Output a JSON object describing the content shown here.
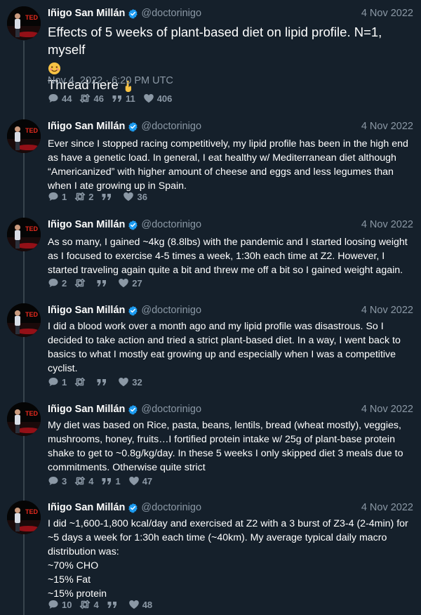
{
  "author": {
    "name": "Iñigo San Millán",
    "handle": "@doctorinigo",
    "avatar_text": "TED"
  },
  "colors": {
    "background": "#15202b",
    "text": "#ffffff",
    "muted": "#8b98a5",
    "verified": "#1d9bf0",
    "thread_line": "#38444d"
  },
  "tweets": [
    {
      "date": "4 Nov 2022",
      "lines": [
        "Effects of 5 weeks of plant-based diet on lipid profile. N=1, myself"
      ],
      "line2": "Thread here",
      "timestamp": "Nov 4, 2022 · 6:20 PM UTC",
      "replies": "44",
      "retweets": "46",
      "quotes": "11",
      "likes": "406"
    },
    {
      "date": "4 Nov 2022",
      "lines": [
        "Ever since I stopped racing competitively, my lipid profile has been in the high end",
        "as have a genetic load. In general, I eat healthy w/ Mediterranean diet although",
        "“Americanized” with higher amount of cheese and eggs and less legumes than",
        "when I ate growing up in Spain."
      ],
      "replies": "1",
      "retweets": "2",
      "quotes": "",
      "likes": "36"
    },
    {
      "date": "4 Nov 2022",
      "lines": [
        "As so many, I gained ~4kg (8.8lbs) with the pandemic and I started loosing weight",
        "as I focused to exercise 4-5 times a week, 1:30h each time at Z2. However, I",
        "started traveling again quite a bit and threw me off a bit so I gained weight again."
      ],
      "replies": "2",
      "retweets": "",
      "quotes": "",
      "likes": "27"
    },
    {
      "date": "4 Nov 2022",
      "lines": [
        "I did a blood work over a month ago and my lipid profile was disastrous. So I",
        "decided to take action and tried a strict plant-based diet. In a way, I went back to",
        "basics to what I mostly eat growing up and especially when I was a competitive",
        "cyclist."
      ],
      "replies": "1",
      "retweets": "",
      "quotes": "",
      "likes": "32"
    },
    {
      "date": "4 Nov 2022",
      "lines": [
        "My diet was based on Rice, pasta, beans, lentils, bread (wheat mostly), veggies,",
        "mushrooms, honey, fruits…I fortified protein intake w/ 25g of plant-base protein",
        "shake to get to ~0.8g/kg/day. In these 5 weeks I only skipped diet 3 meals due to",
        "commitments. Otherwise quite strict"
      ],
      "replies": "3",
      "retweets": "4",
      "quotes": "1",
      "likes": "47"
    },
    {
      "date": "4 Nov 2022",
      "lines": [
        "I did ~1,600-1,800 kcal/day and exercised at Z2 with a 3 burst of Z3-4 (2-4min) for",
        "~5 days a week for 1:30h each time (~40km). My average typical daily macro",
        "distribution was:",
        "~70% CHO",
        "~15% Fat",
        "~15% protein"
      ],
      "replies": "10",
      "retweets": "4",
      "quotes": "",
      "likes": "48"
    }
  ]
}
